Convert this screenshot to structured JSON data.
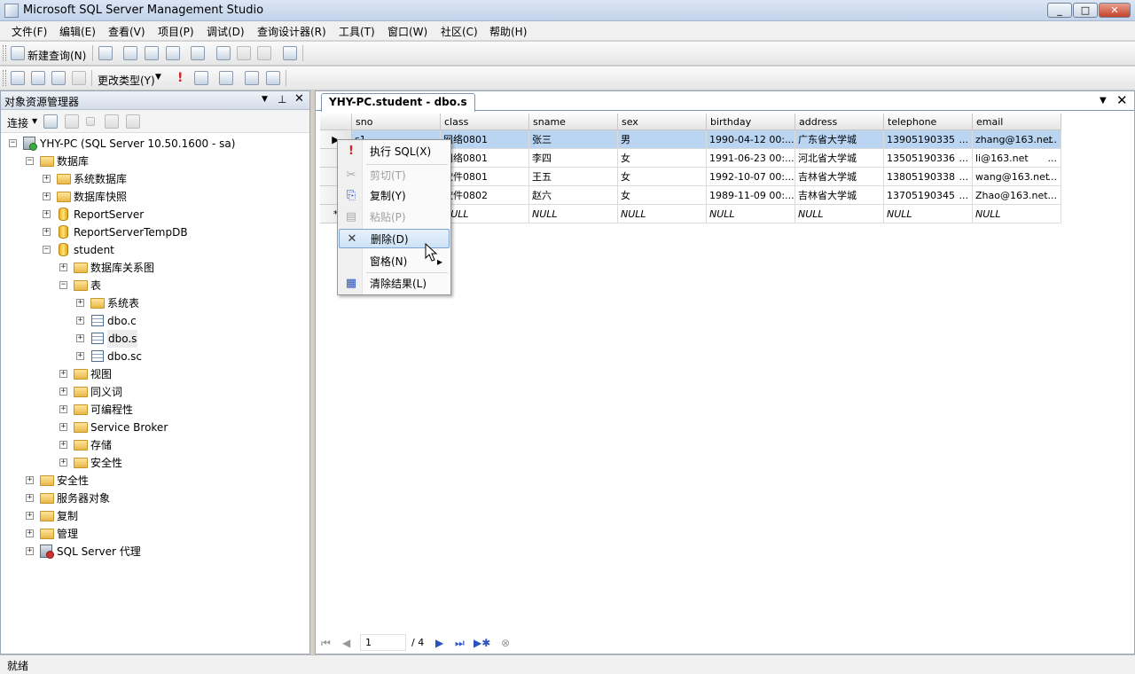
{
  "window": {
    "title": "Microsoft SQL Server Management Studio",
    "minimize": "_",
    "maximize": "□",
    "close": "✕"
  },
  "menu": [
    "文件(F)",
    "编辑(E)",
    "查看(V)",
    "项目(P)",
    "调试(D)",
    "查询设计器(R)",
    "工具(T)",
    "窗口(W)",
    "社区(C)",
    "帮助(H)"
  ],
  "toolbar1": {
    "new_query": "新建查询(N)"
  },
  "toolbar2": {
    "change_type": "更改类型(Y)"
  },
  "explorer": {
    "title": "对象资源管理器",
    "connect": "连接",
    "tree": [
      {
        "label": "YHY-PC (SQL Server 10.50.1600 - sa)"
      },
      {
        "label": "数据库"
      },
      {
        "label": "系统数据库"
      },
      {
        "label": "数据库快照"
      },
      {
        "label": "ReportServer"
      },
      {
        "label": "ReportServerTempDB"
      },
      {
        "label": "student"
      },
      {
        "label": "数据库关系图"
      },
      {
        "label": "表"
      },
      {
        "label": "系统表"
      },
      {
        "label": "dbo.c"
      },
      {
        "label": "dbo.s"
      },
      {
        "label": "dbo.sc"
      },
      {
        "label": "视图"
      },
      {
        "label": "同义词"
      },
      {
        "label": "可编程性"
      },
      {
        "label": "Service Broker"
      },
      {
        "label": "存储"
      },
      {
        "label": "安全性"
      },
      {
        "label": "安全性"
      },
      {
        "label": "服务器对象"
      },
      {
        "label": "复制"
      },
      {
        "label": "管理"
      },
      {
        "label": "SQL Server 代理"
      }
    ]
  },
  "document": {
    "tab": "YHY-PC.student - dbo.s",
    "columns": [
      "sno",
      "class",
      "sname",
      "sex",
      "birthday",
      "address",
      "telephone",
      "email"
    ],
    "rows": [
      {
        "sno": "s1",
        "class": "网络0801",
        "sname": "张三",
        "sex": "男",
        "birthday": "1990-04-12 00:...",
        "address": "广东省大学城",
        "telephone": "13905190335",
        "email": "zhang@163.net"
      },
      {
        "sno": "",
        "class": "网络0801",
        "sname": "李四",
        "sex": "女",
        "birthday": "1991-06-23 00:...",
        "address": "河北省大学城",
        "telephone": "13505190336",
        "email": "li@163.net"
      },
      {
        "sno": "",
        "class": "软件0801",
        "sname": "王五",
        "sex": "女",
        "birthday": "1992-10-07 00:...",
        "address": "吉林省大学城",
        "telephone": "13805190338",
        "email": "wang@163.net"
      },
      {
        "sno": "",
        "class": "软件0802",
        "sname": "赵六",
        "sex": "女",
        "birthday": "1989-11-09 00:...",
        "address": "吉林省大学城",
        "telephone": "13705190345",
        "email": "Zhao@163.net"
      }
    ],
    "null_text": "NULL",
    "ellipsis": "...",
    "new_row_marker": "*",
    "current_row_marker": "▶",
    "pager": {
      "page": "1",
      "total": "/ 4"
    }
  },
  "context_menu": {
    "items": [
      {
        "label": "执行 SQL(X)",
        "icon": "!"
      },
      {
        "label": "剪切(T)",
        "icon": "✂"
      },
      {
        "label": "复制(Y)",
        "icon": "⎘"
      },
      {
        "label": "粘贴(P)",
        "icon": "▤"
      },
      {
        "label": "删除(D)",
        "icon": "✕"
      },
      {
        "label": "窗格(N)",
        "icon": "▸"
      },
      {
        "label": "清除结果(L)",
        "icon": "▦"
      }
    ]
  },
  "status": {
    "text": "就绪"
  },
  "colors": {
    "selection": "#b9d5f2",
    "accent": "#2a52be"
  }
}
